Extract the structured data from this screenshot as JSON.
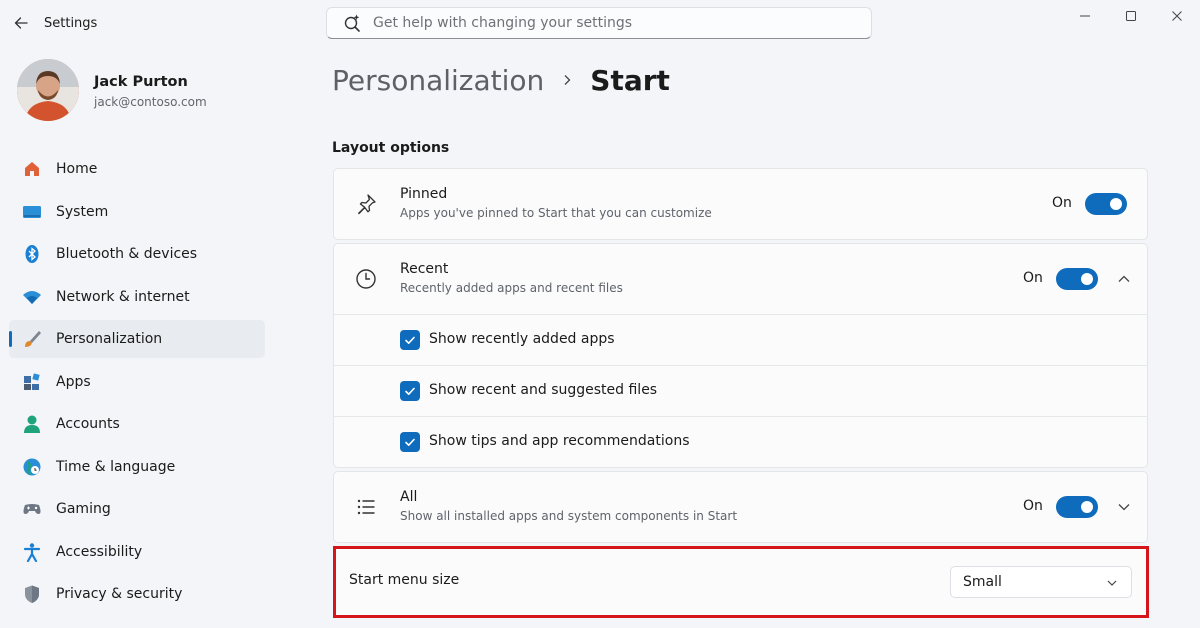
{
  "window": {
    "title": "Settings",
    "icons": {
      "back": "back-arrow-icon",
      "minimize": "minimize-icon",
      "maximize": "maximize-icon",
      "close": "close-icon"
    }
  },
  "search": {
    "placeholder": "Get help with changing your settings",
    "value": "",
    "icon": "search-sparkle-icon"
  },
  "profile": {
    "name": "Jack Purton",
    "email": "jack@contoso.com"
  },
  "sidebar": {
    "items": [
      {
        "label": "Home",
        "icon": "home-icon",
        "selected": false
      },
      {
        "label": "System",
        "icon": "monitor-icon",
        "selected": false
      },
      {
        "label": "Bluetooth & devices",
        "icon": "bluetooth-icon",
        "selected": false
      },
      {
        "label": "Network & internet",
        "icon": "wifi-icon",
        "selected": false
      },
      {
        "label": "Personalization",
        "icon": "brush-icon",
        "selected": true
      },
      {
        "label": "Apps",
        "icon": "apps-icon",
        "selected": false
      },
      {
        "label": "Accounts",
        "icon": "person-icon",
        "selected": false
      },
      {
        "label": "Time & language",
        "icon": "globe-clock-icon",
        "selected": false
      },
      {
        "label": "Gaming",
        "icon": "gamepad-icon",
        "selected": false
      },
      {
        "label": "Accessibility",
        "icon": "accessibility-icon",
        "selected": false
      },
      {
        "label": "Privacy & security",
        "icon": "shield-icon",
        "selected": false
      }
    ]
  },
  "breadcrumb": {
    "parent": "Personalization",
    "current": "Start"
  },
  "main": {
    "section_title": "Layout options",
    "pinned": {
      "title": "Pinned",
      "description": "Apps you've pinned to Start that you can customize",
      "state": "On",
      "icon": "pin-icon"
    },
    "recent": {
      "title": "Recent",
      "description": "Recently added apps and recent files",
      "state": "On",
      "icon": "clock-icon",
      "options": [
        {
          "label": "Show recently added apps",
          "checked": true
        },
        {
          "label": "Show recent and suggested files",
          "checked": true
        },
        {
          "label": "Show tips and app recommendations",
          "checked": true
        }
      ]
    },
    "all": {
      "title": "All",
      "description": "Show all installed apps and system components in Start",
      "state": "On",
      "icon": "list-icon"
    },
    "menu_size": {
      "label": "Start menu size",
      "value": "Small"
    }
  },
  "colors": {
    "accent": "#0f6cbd",
    "highlight": "#d6151b"
  }
}
